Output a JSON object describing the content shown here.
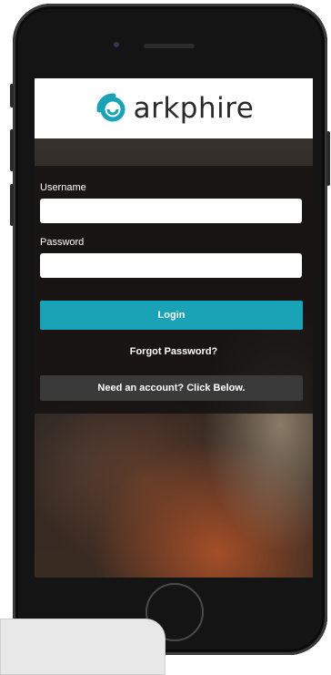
{
  "brand": {
    "name": "arkphire",
    "accent_color": "#1aa3b7"
  },
  "login_form": {
    "username_label": "Username",
    "username_value": "",
    "password_label": "Password",
    "password_value": "",
    "login_button_label": "Login",
    "forgot_password_link": "Forgot Password?",
    "create_account_label": "Need an account? Click Below."
  },
  "icons": {
    "logo_mark": "arkphire-swirl-logo-icon",
    "camera": "front-camera-icon",
    "home": "home-button-icon"
  }
}
